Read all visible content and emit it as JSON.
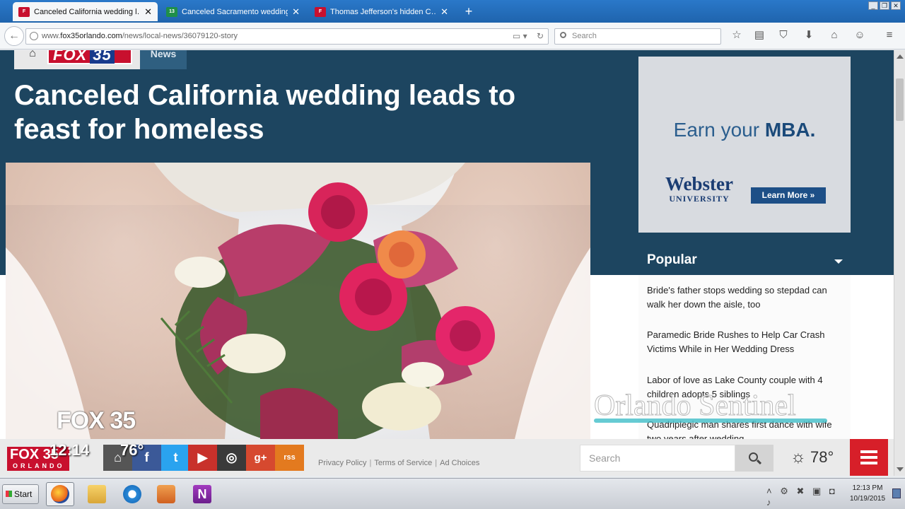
{
  "browser": {
    "tabs": [
      {
        "title": "Canceled California wedding l…",
        "favicon": "FOX",
        "favicon_color": "#c8102e",
        "active": true
      },
      {
        "title": "Canceled Sacramento wedding …",
        "favicon": "13",
        "favicon_color": "#1f8f4a",
        "active": false
      },
      {
        "title": "Thomas Jefferson's hidden C…",
        "favicon": "FOX",
        "favicon_color": "#c8102e",
        "active": false
      }
    ],
    "new_tab": "+",
    "url_prefix": "www.",
    "url_domain": "fox35orlando.com",
    "url_path": "/news/local-news/36079120-story",
    "search_placeholder": "Search"
  },
  "page": {
    "section_tab": "News",
    "logo_text": "FOX",
    "logo_num": "35",
    "headline": "Canceled California wedding leads to feast for homeless",
    "ad": {
      "tagline_prefix": "Earn your ",
      "tagline_bold": "MBA.",
      "school_name": "Webster",
      "school_sub": "UNIVERSITY",
      "cta": "Learn More »"
    },
    "popular": {
      "heading": "Popular",
      "items": [
        "Bride's father stops wedding so stepdad can walk her down the aisle, too",
        "Paramedic Bride Rushes to Help Car Crash Victims While in Her Wedding Dress",
        "Labor of love as Lake County couple with 4 children adopts 5 siblings",
        "Quadriplegic man shares first dance with wife two years after wedding"
      ]
    },
    "footer": {
      "legal": [
        "Privacy Policy",
        "Terms of Service",
        "Ad Choices"
      ],
      "search_placeholder": "Search",
      "temperature": "78°",
      "social": [
        "f",
        "t",
        "▶",
        "◎",
        "g+",
        "rss"
      ]
    }
  },
  "overlay": {
    "sentinel": "Orlando Sentinel",
    "station": "FOX 35",
    "bug_name": "FOX 35",
    "bug_city": "ORLANDO",
    "time": "12:14",
    "temp": "76°"
  },
  "taskbar": {
    "start": "Start",
    "clock_time": "12:13 PM",
    "clock_date": "10/19/2015"
  }
}
